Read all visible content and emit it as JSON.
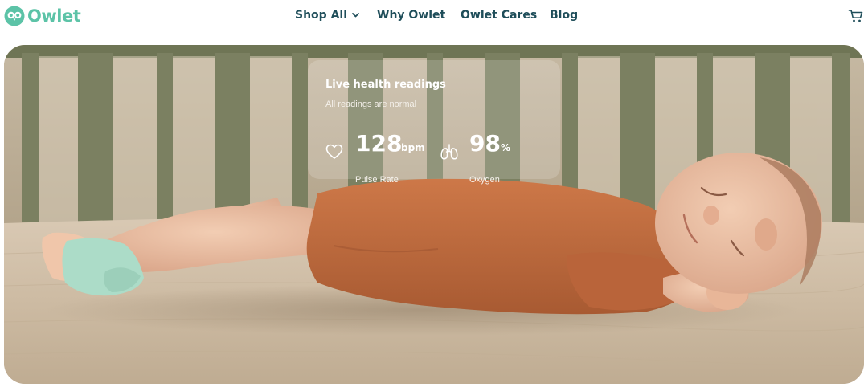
{
  "header": {
    "logo_text": "Owlet",
    "logo_icon": "owl-logo-icon",
    "nav": [
      {
        "label": "Shop All",
        "has_dropdown": true
      },
      {
        "label": "Why Owlet"
      },
      {
        "label": "Owlet Cares"
      },
      {
        "label": "Blog"
      }
    ],
    "cart_icon": "cart-icon"
  },
  "hero": {
    "image": "sleeping baby in orange romper on crib mattress wearing sock monitor",
    "readings": {
      "title": "Live health readings",
      "subtitle": "All readings are normal",
      "pulse": {
        "value": "128",
        "unit": "bpm",
        "label": "Pulse Rate",
        "icon": "heart-icon"
      },
      "oxygen": {
        "value": "98",
        "unit": "%",
        "label": "Oxygen",
        "icon": "lungs-icon"
      }
    }
  },
  "colors": {
    "brand": "#5cc3a7",
    "nav_text": "#1f4e5a",
    "crib": "#7d8262",
    "mattress": "#d7c6b1",
    "romper": "#c06a3c",
    "sock": "#a8d9c5"
  }
}
